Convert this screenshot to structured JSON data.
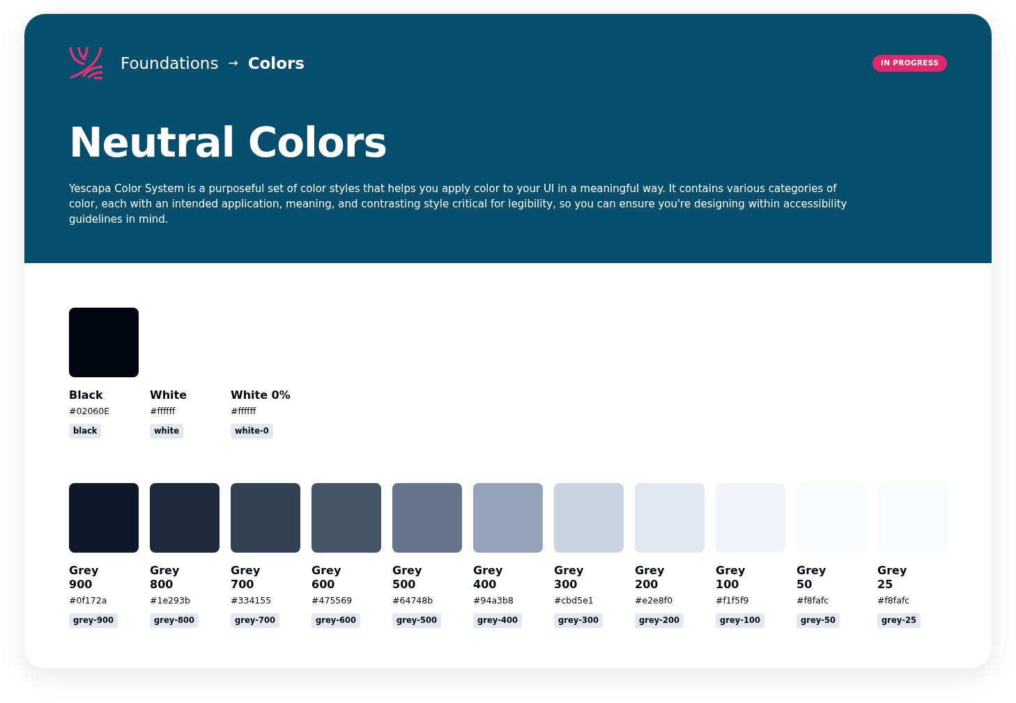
{
  "breadcrumb": {
    "parent": "Foundations",
    "separator": "→",
    "current": "Colors"
  },
  "status_badge": "IN PROGRESS",
  "title": "Neutral Colors",
  "description": "Yescapa Color System is a purposeful set of color styles that helps you apply color to your UI in a meaningful way. It contains various categories of color, each with an intended application, meaning, and contrasting style critical for legibility, so you can ensure you're designing within accessibility guidelines in mind.",
  "groups": [
    {
      "colors": [
        {
          "name": "Black",
          "hex": "#02060E",
          "token": "black",
          "color": "#02060e"
        },
        {
          "name": "White",
          "hex": "#ffffff",
          "token": "white"
        },
        {
          "name": "White 0%",
          "hex": "#ffffff",
          "token": "white-0"
        }
      ]
    },
    {
      "colors": [
        {
          "name": "Grey 900",
          "hex": "#0f172a",
          "token": "grey-900",
          "color": "#0f172a"
        },
        {
          "name": "Grey 800",
          "hex": "#1e293b",
          "token": "grey-800",
          "color": "#1e293b"
        },
        {
          "name": "Grey 700",
          "hex": "#334155",
          "token": "grey-700",
          "color": "#334155"
        },
        {
          "name": "Grey 600",
          "hex": "#475569",
          "token": "grey-600",
          "color": "#475569"
        },
        {
          "name": "Grey 500",
          "hex": "#64748b",
          "token": "grey-500",
          "color": "#64748b"
        },
        {
          "name": "Grey 400",
          "hex": "#94a3b8",
          "token": "grey-400",
          "color": "#94a3b8"
        },
        {
          "name": "Grey 300",
          "hex": "#cbd5e1",
          "token": "grey-300",
          "color": "#cbd5e1"
        },
        {
          "name": "Grey 200",
          "hex": "#e2e8f0",
          "token": "grey-200",
          "color": "#e2e8f0"
        },
        {
          "name": "Grey 100",
          "hex": "#f1f5f9",
          "token": "grey-100",
          "color": "#f1f5f9"
        },
        {
          "name": "Grey 50",
          "hex": "#f8fafc",
          "token": "grey-50",
          "color": "#f8fafc"
        },
        {
          "name": "Grey 25",
          "hex": "#f8fafc",
          "token": "grey-25",
          "color": "#f8fafc"
        }
      ]
    }
  ]
}
